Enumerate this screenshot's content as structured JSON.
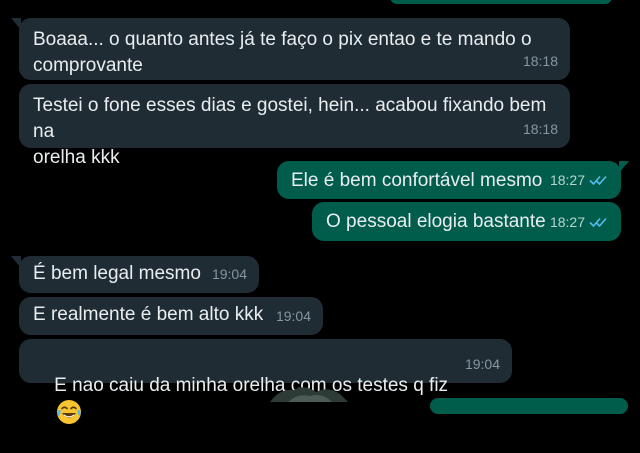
{
  "theme": {
    "incoming_bg": "#1f2c34",
    "outgoing_bg": "#005c4b",
    "read_check_color": "#53bdeb"
  },
  "messages": [
    {
      "direction": "in",
      "text": "Boaaa... o quanto antes já te faço o pix entao e te mando o\ncomprovante",
      "time": "18:18"
    },
    {
      "direction": "in",
      "text": "Testei o fone esses dias e gostei, hein... acabou fixando bem na\norelha kkk",
      "time": "18:18"
    },
    {
      "direction": "out",
      "text": "Ele é bem confortável mesmo",
      "time": "18:27",
      "status_icon": "double-check-read-icon"
    },
    {
      "direction": "out",
      "text": "O pessoal elogia bastante",
      "time": "18:27",
      "status_icon": "double-check-read-icon"
    },
    {
      "direction": "in",
      "text": "É bem legal mesmo",
      "time": "19:04"
    },
    {
      "direction": "in",
      "text": "E realmente é bem alto kkk",
      "time": "19:04"
    },
    {
      "direction": "in",
      "text": "E nao caiu da minha orelha com os testes q fiz",
      "emoji": "tears-of-joy-emoji-icon",
      "time": "19:04"
    }
  ]
}
